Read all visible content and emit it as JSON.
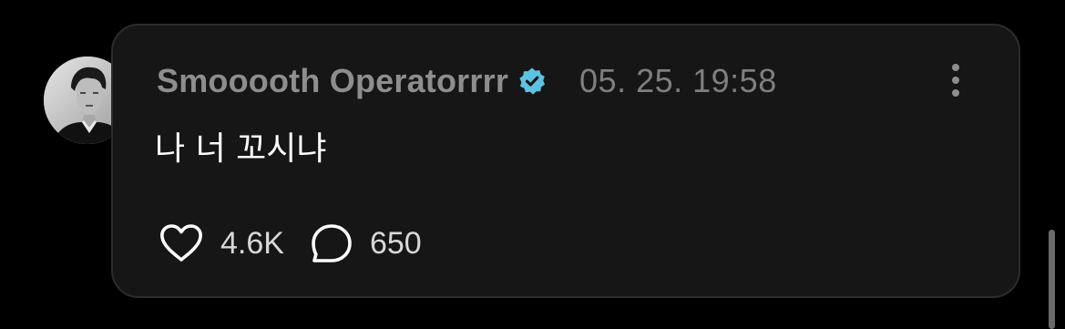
{
  "post": {
    "username": "Smooooth Operatorrrr",
    "timestamp": "05. 25. 19:58",
    "text": "나 너 꼬시냐",
    "like_count": "4.6K",
    "reply_count": "650"
  },
  "icons": {
    "verified": "verified-badge-icon",
    "more": "more-vertical-icon",
    "like": "heart-icon",
    "reply": "speech-bubble-icon"
  },
  "colors": {
    "background": "#000000",
    "card": "#161616",
    "verified_badge": "#5ec3e3",
    "username": "#8e8e8e",
    "post_text": "#ffffff"
  }
}
